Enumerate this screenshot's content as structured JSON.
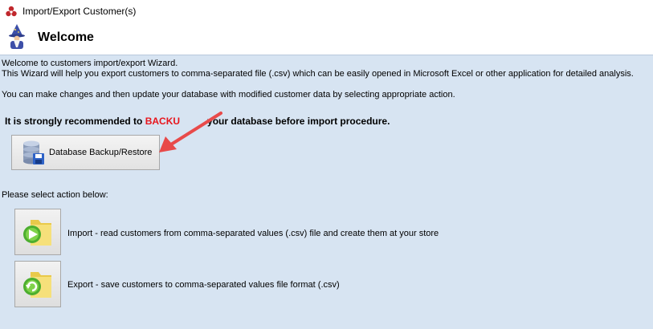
{
  "window": {
    "title": "Import/Export Customer(s)",
    "icon": "app-logo-icon"
  },
  "header": {
    "title": "Welcome",
    "icon": "wizard-icon"
  },
  "intro": {
    "line1": "Welcome to customers import/export Wizard.",
    "line2": "This Wizard will help you export customers to comma-separated file (.csv) which can be easily opened in Microsoft Excel or other application for detailed analysis.",
    "line3": "You can make changes and then update your database with modified customer data by selecting appropriate action."
  },
  "warning": {
    "prefix": "It is strongly recommended to ",
    "highlight": "BACKU",
    "suffix": "your database before import procedure."
  },
  "backup_button": {
    "label": "Database Backup/Restore",
    "icon": "database-icon"
  },
  "select_prompt": "Please select action below:",
  "actions": [
    {
      "label": "Import - read customers from comma-separated values (.csv) file and create them at your store",
      "icon": "import-folder-icon"
    },
    {
      "label": "Export - save customers to comma-separated values file format (.csv)",
      "icon": "export-folder-icon"
    }
  ],
  "colors": {
    "panel": "#d7e4f2",
    "warning_highlight": "#e8141b",
    "arrow": "#e84a4a"
  }
}
